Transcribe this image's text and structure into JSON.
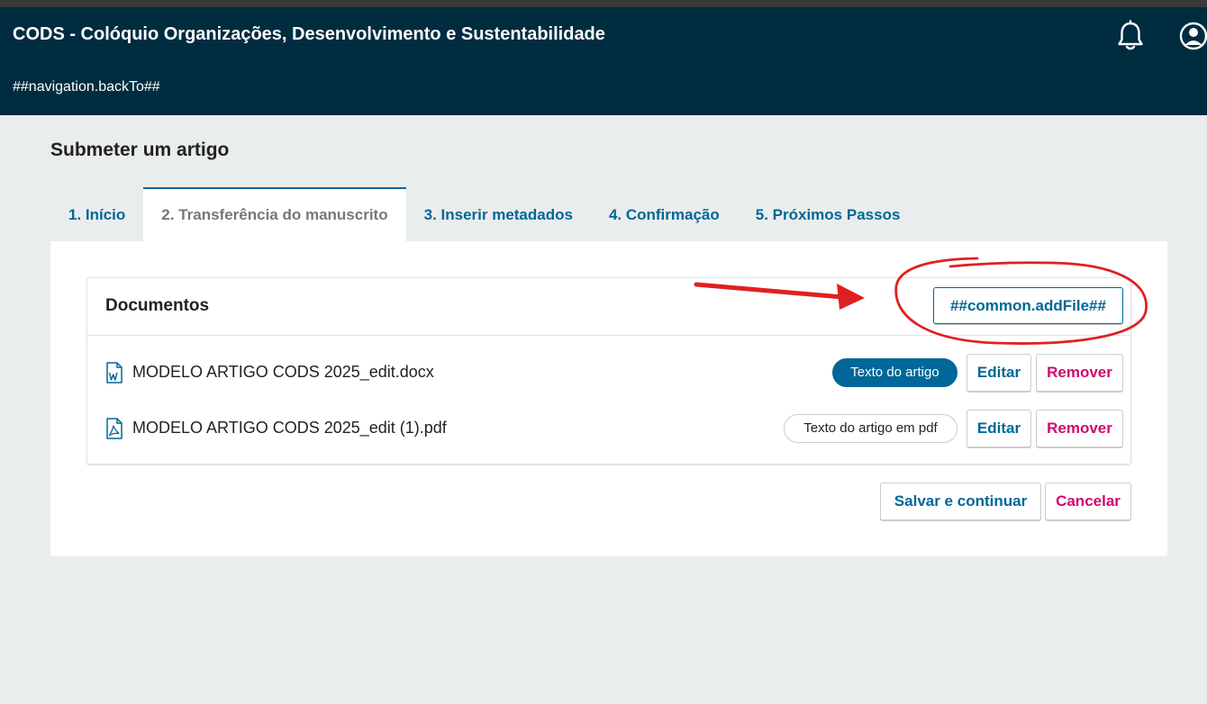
{
  "header": {
    "site_title": "CODS - Colóquio Organizações, Desenvolvimento e Sustentabilidade",
    "back_link": "##navigation.backTo##",
    "notifications_icon": "bell-icon",
    "user_icon": "user-circle-icon"
  },
  "page": {
    "title": "Submeter um artigo"
  },
  "tabs": [
    {
      "label": "1. Início",
      "active": false
    },
    {
      "label": "2. Transferência do manuscrito",
      "active": true
    },
    {
      "label": "3. Inserir metadados",
      "active": false
    },
    {
      "label": "4. Confirmação",
      "active": false
    },
    {
      "label": "5. Próximos Passos",
      "active": false
    }
  ],
  "documents": {
    "title": "Documentos",
    "add_file_label": "##common.addFile##",
    "files": [
      {
        "name": "MODELO ARTIGO CODS 2025_edit.docx",
        "icon": "word-file-icon",
        "genre": "Texto do artigo",
        "edit_label": "Editar",
        "remove_label": "Remover"
      },
      {
        "name": "MODELO ARTIGO CODS 2025_edit (1).pdf",
        "icon": "pdf-file-icon",
        "genre": "Texto do artigo em pdf",
        "edit_label": "Editar",
        "remove_label": "Remover"
      }
    ]
  },
  "actions": {
    "save_label": "Salvar e continuar",
    "cancel_label": "Cancelar"
  },
  "colors": {
    "header_bg": "#002c40",
    "accent": "#006798",
    "danger": "#d00a6c",
    "annotation": "#e02020"
  }
}
